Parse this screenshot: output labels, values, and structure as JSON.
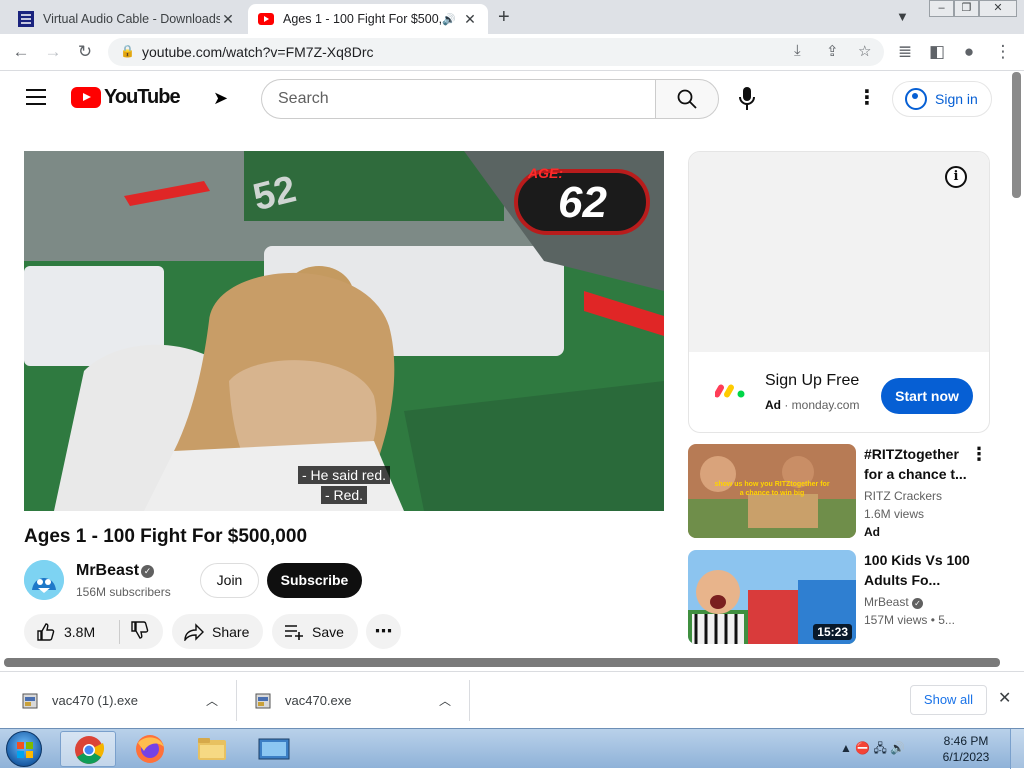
{
  "browser": {
    "tabs": [
      {
        "title": "Virtual Audio Cable - Downloads",
        "active": false
      },
      {
        "title": "Ages 1 - 100 Fight For $500,000",
        "active": true,
        "audio": true
      }
    ],
    "new_tab_label": "+",
    "url": "youtube.com/watch?v=FM7Z-Xq8Drc"
  },
  "youtube": {
    "logo_text": "YouTube",
    "search_placeholder": "Search",
    "sign_in_label": "Sign in"
  },
  "video": {
    "age_label": "AGE:",
    "age_value": "62",
    "captions": [
      "- He said red.",
      "- Red."
    ],
    "title": "Ages 1 - 100 Fight For $500,000",
    "channel": "MrBeast",
    "subscribers": "156M subscribers",
    "join_label": "Join",
    "subscribe_label": "Subscribe",
    "likes": "3.8M",
    "share_label": "Share",
    "save_label": "Save"
  },
  "sidebar": {
    "ad": {
      "headline": "Sign Up Free",
      "badge": "Ad",
      "domain": "monday.com",
      "cta": "Start now"
    },
    "recommendations": [
      {
        "title": "#RITZtogether for a chance t...",
        "channel": "RITZ Crackers",
        "views": "1.6M views",
        "ad_badge": "Ad",
        "thumb_text": "show us how you RITZtogether for a chance to win big"
      },
      {
        "title": "100 Kids Vs 100 Adults Fo...",
        "channel": "MrBeast",
        "views": "157M views",
        "age": "5...",
        "duration": "15:23"
      }
    ]
  },
  "downloads": {
    "items": [
      {
        "filename": "vac470 (1).exe"
      },
      {
        "filename": "vac470.exe"
      }
    ],
    "show_all_label": "Show all"
  },
  "taskbar": {
    "time": "8:46 PM",
    "date": "6/1/2023"
  }
}
